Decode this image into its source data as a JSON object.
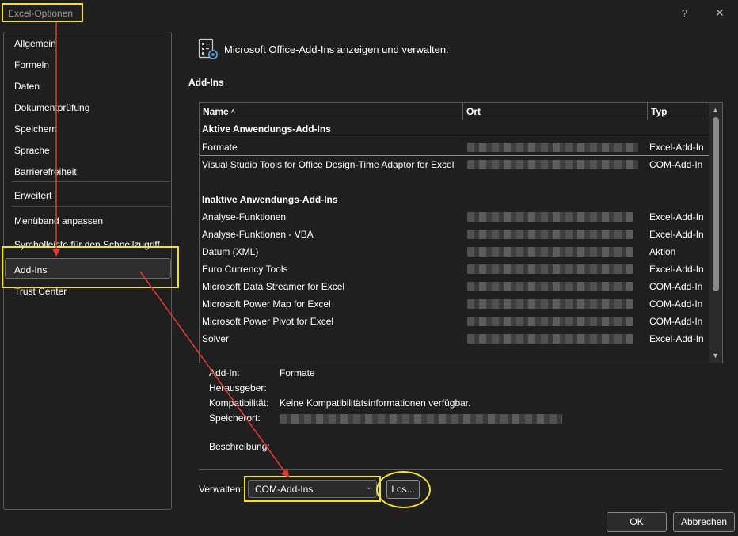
{
  "window": {
    "title": "Excel-Optionen",
    "help_glyph": "?",
    "close_glyph": "✕"
  },
  "sidebar": {
    "items": [
      {
        "label": "Allgemein"
      },
      {
        "label": "Formeln"
      },
      {
        "label": "Daten"
      },
      {
        "label": "Dokumentprüfung"
      },
      {
        "label": "Speichern"
      },
      {
        "label": "Sprache"
      },
      {
        "label": "Barrierefreiheit"
      },
      {
        "label": "Erweitert"
      },
      {
        "label": "Menüband anpassen"
      },
      {
        "label": "Symbolleiste für den Schnellzugriff"
      },
      {
        "label": "Add-Ins",
        "selected": true
      },
      {
        "label": "Trust Center"
      }
    ]
  },
  "main": {
    "header": "Microsoft Office-Add-Ins anzeigen und verwalten.",
    "section_title": "Add-Ins",
    "table": {
      "columns": {
        "name": "Name",
        "sort_glyph": "^",
        "location": "Ort",
        "type": "Typ"
      },
      "groups": [
        {
          "title": "Aktive Anwendungs-Add-Ins",
          "rows": [
            {
              "name": "Formate",
              "type": "Excel-Add-In",
              "selected": true
            },
            {
              "name": "Visual Studio Tools for Office Design-Time Adaptor for Excel",
              "type": "COM-Add-In"
            }
          ]
        },
        {
          "title": "Inaktive Anwendungs-Add-Ins",
          "rows": [
            {
              "name": "Analyse-Funktionen",
              "type": "Excel-Add-In"
            },
            {
              "name": "Analyse-Funktionen - VBA",
              "type": "Excel-Add-In"
            },
            {
              "name": "Datum (XML)",
              "type": "Aktion"
            },
            {
              "name": "Euro Currency Tools",
              "type": "Excel-Add-In"
            },
            {
              "name": "Microsoft Data Streamer for Excel",
              "type": "COM-Add-In"
            },
            {
              "name": "Microsoft Power Map for Excel",
              "type": "COM-Add-In"
            },
            {
              "name": "Microsoft Power Pivot for Excel",
              "type": "COM-Add-In"
            },
            {
              "name": "Solver",
              "type": "Excel-Add-In"
            }
          ]
        }
      ],
      "scroll_up_glyph": "▲",
      "scroll_down_glyph": "▼"
    },
    "details": {
      "addin_label": "Add-In:",
      "addin_value": "Formate",
      "publisher_label": "Herausgeber:",
      "compat_label": "Kompatibilität:",
      "compat_value": "Keine Kompatibilitätsinformationen verfügbar.",
      "location_label": "Speicherort:",
      "description_label": "Beschreibung:"
    },
    "manage": {
      "label": "Verwalten:",
      "selected": "COM-Add-Ins",
      "go_button": "Los..."
    }
  },
  "footer": {
    "ok": "OK",
    "cancel": "Abbrechen"
  },
  "colors": {
    "background": "#1f1f1f",
    "highlight": "#f4e12a",
    "arrow": "#e53935"
  }
}
